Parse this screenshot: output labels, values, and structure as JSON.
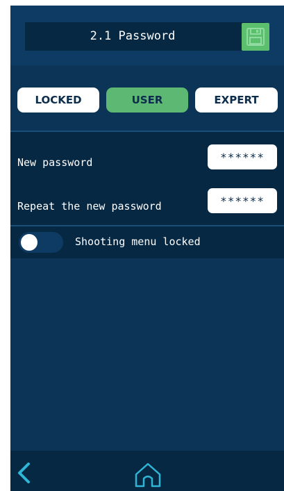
{
  "header": {
    "title": "2.1 Password"
  },
  "modes": {
    "locked": "LOCKED",
    "user": "USER",
    "expert": "EXPERT",
    "selected": "USER"
  },
  "password": {
    "new_label": "New password",
    "new_value": "******",
    "repeat_label": "Repeat the new password",
    "repeat_value": "******"
  },
  "shooting_menu": {
    "label": "Shooting menu locked",
    "enabled": false
  },
  "footer": {
    "back_icon": "chevron-left-icon",
    "home_icon": "home-icon"
  },
  "colors": {
    "background": "#0b3457",
    "panel_dark": "#072843",
    "accent_green": "#5cb873",
    "accent_cyan": "#2fb5d6"
  }
}
